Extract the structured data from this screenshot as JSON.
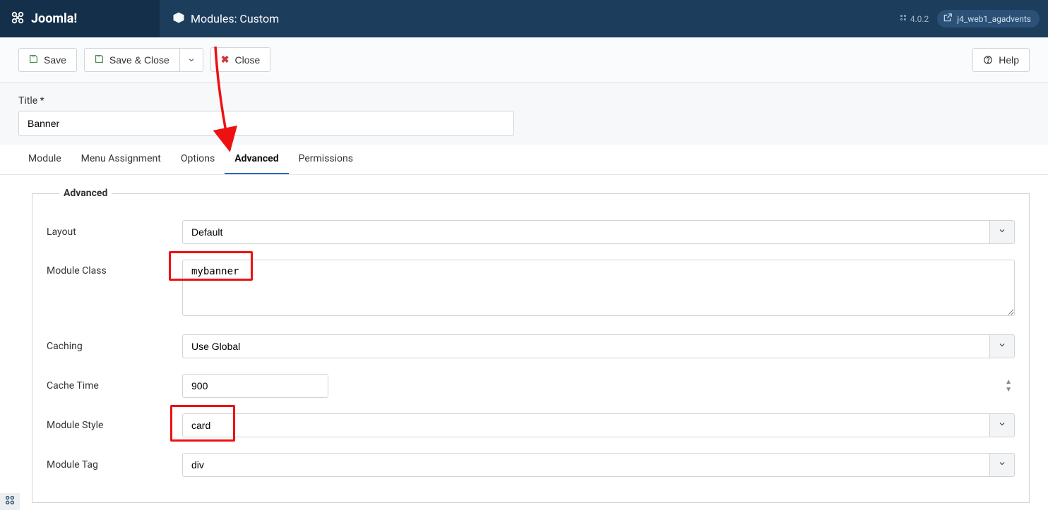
{
  "brand": "Joomla!",
  "page_title": "Modules: Custom",
  "version": "4.0.2",
  "site_name": "j4_web1_agadvents",
  "toolbar": {
    "save": "Save",
    "save_close": "Save & Close",
    "close": "Close",
    "help": "Help"
  },
  "title_field": {
    "label": "Title *",
    "value": "Banner"
  },
  "tabs": [
    {
      "label": "Module"
    },
    {
      "label": "Menu Assignment"
    },
    {
      "label": "Options"
    },
    {
      "label": "Advanced"
    },
    {
      "label": "Permissions"
    }
  ],
  "fieldset_legend": "Advanced",
  "form": {
    "layout": {
      "label": "Layout",
      "value": "Default"
    },
    "module_class": {
      "label": "Module Class",
      "value": "mybanner"
    },
    "caching": {
      "label": "Caching",
      "value": "Use Global"
    },
    "cache_time": {
      "label": "Cache Time",
      "value": "900"
    },
    "module_style": {
      "label": "Module Style",
      "value": "card"
    },
    "module_tag": {
      "label": "Module Tag",
      "value": "div"
    }
  }
}
